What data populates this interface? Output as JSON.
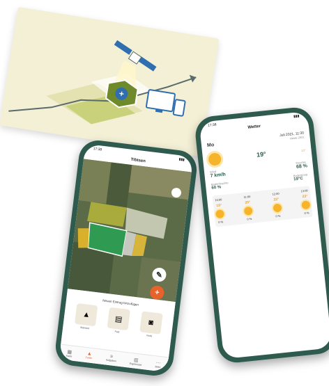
{
  "illustration": {
    "plus_symbol": "+"
  },
  "fields_app": {
    "status_time": "17:38",
    "title": "Tibtsen",
    "sheet_title": "Neuen Eintrag hinzufügen",
    "tiles": [
      {
        "label": "Standort",
        "icon": "pin-icon",
        "glyph": "▲"
      },
      {
        "label": "Feld",
        "icon": "field-icon",
        "glyph": "▤"
      },
      {
        "label": "Notiz",
        "icon": "camera-icon",
        "glyph": "◙"
      }
    ],
    "nav": [
      {
        "label": "Karte",
        "icon": "map-icon",
        "glyph": "▦",
        "active": false
      },
      {
        "label": "Felder",
        "icon": "field-icon",
        "glyph": "▲",
        "active": true
      },
      {
        "label": "Aufgaben",
        "icon": "tasks-icon",
        "glyph": "≡",
        "active": false
      },
      {
        "label": "Ergebnisse",
        "icon": "results-icon",
        "glyph": "▥",
        "active": false
      },
      {
        "label": "Mehr",
        "icon": "more-icon",
        "glyph": "⋯",
        "active": false
      }
    ],
    "fab_primary": "+",
    "fab_secondary": "✎",
    "colors": {
      "accent": "#e8622b",
      "frame": "#2f5a4e"
    }
  },
  "weather_app": {
    "status_time": "17:38",
    "title": "Wetter",
    "day": "Mo",
    "date_line": "Juli 2021, 11:30",
    "date_sub": "Heute 2021",
    "temp_now": "19°",
    "temp_side": "23°",
    "wind": "7 km/h",
    "wind_label": "Wind",
    "humidity": "68 %",
    "humidity_label": "Feuchte",
    "soil": "60 %",
    "soil_label": "Bodenfeuchte",
    "soil_temp": "19°C",
    "soil_temp_label": "Bodentemp.",
    "forecast": [
      {
        "day": "10:00",
        "temp": "19°",
        "rain": "0 %"
      },
      {
        "day": "11:00",
        "temp": "20°",
        "rain": "0 %"
      },
      {
        "day": "12:00",
        "temp": "22°",
        "rain": "0 %"
      },
      {
        "day": "13:00",
        "temp": "23°",
        "rain": "0 %"
      }
    ],
    "colors": {
      "sun": "#f6b42c",
      "brand": "#2f5a4e"
    }
  }
}
